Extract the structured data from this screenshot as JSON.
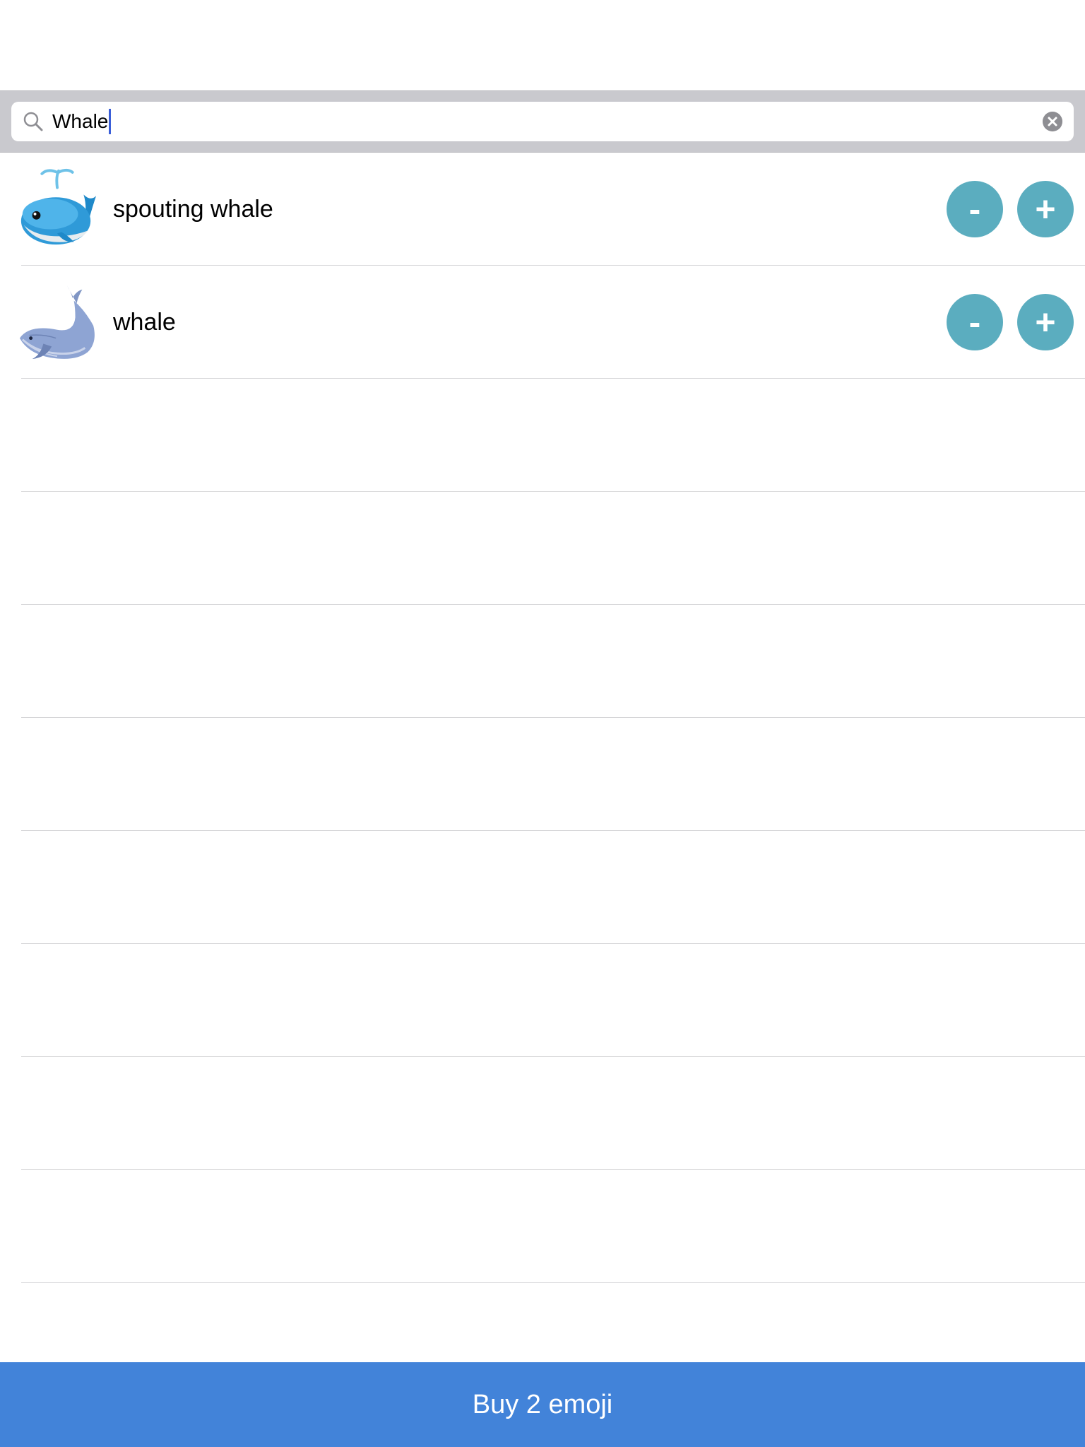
{
  "search": {
    "value": "Whale",
    "icon": "search-icon",
    "clear_icon": "clear-icon"
  },
  "results": [
    {
      "name": "spouting whale",
      "emoji": "🐳",
      "minus_label": "-",
      "plus_label": "+"
    },
    {
      "name": "whale",
      "emoji": "🐋",
      "minus_label": "-",
      "plus_label": "+"
    }
  ],
  "footer": {
    "buy_label": "Buy 2 emoji"
  },
  "colors": {
    "search_bar_bg": "#c9c9ce",
    "stepper_button": "#5badbf",
    "buy_button": "#4283d9",
    "caret": "#3a5ed8"
  }
}
